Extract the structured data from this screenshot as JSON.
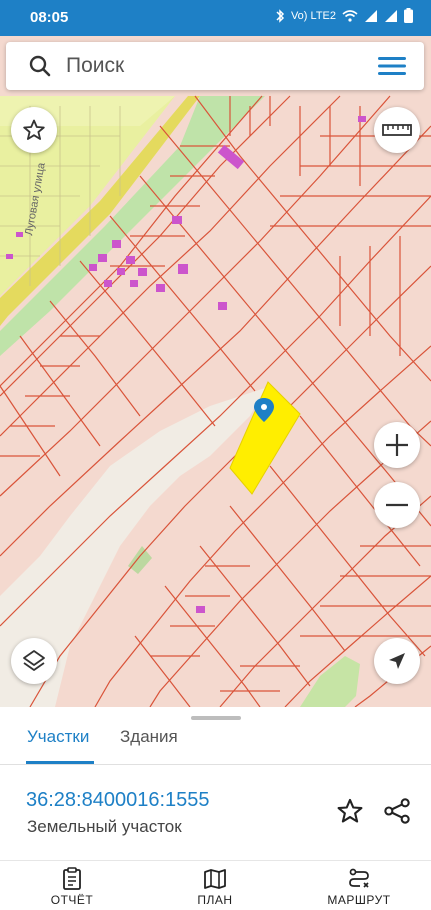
{
  "status_bar": {
    "time": "08:05",
    "icons": [
      "bluetooth-icon",
      "volte-icon",
      "wifi-icon",
      "signal-icon",
      "signal-icon",
      "battery-icon"
    ],
    "network_label": "Vo) LTE2"
  },
  "search": {
    "placeholder": "Поиск"
  },
  "map": {
    "street_label": "Луговая улица",
    "colors": {
      "background": "#f4d9cf",
      "parcel_line": "#d9543a",
      "green": "#b7e2a8",
      "residential": "#e9f0a0",
      "road": "#e8e070",
      "selected": "#ffee00",
      "building": "#cc55cc",
      "river": "#f0eee6"
    }
  },
  "sheet": {
    "tabs": [
      "Участки",
      "Здания"
    ],
    "active_tab": "Участки",
    "parcel_number": "36:28:8400016:1555",
    "parcel_type": "Земельный участок"
  },
  "bottom_nav": {
    "items": [
      {
        "label": "ОТЧЁТ",
        "icon": "report-icon"
      },
      {
        "label": "ПЛАН",
        "icon": "map-plan-icon"
      },
      {
        "label": "МАРШРУТ",
        "icon": "route-icon"
      }
    ]
  },
  "accent_color": "#1e80c6"
}
